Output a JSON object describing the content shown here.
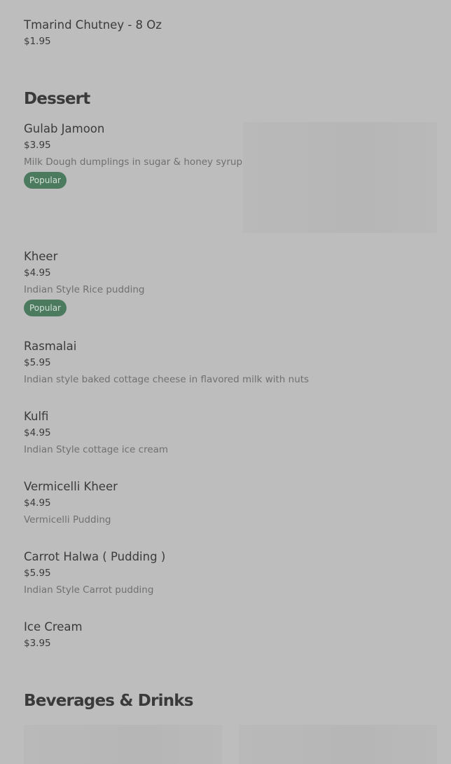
{
  "condiments": {
    "items": [
      {
        "name": "Tmarind Chutney - 8 Oz",
        "price": "$1.95"
      }
    ]
  },
  "dessert": {
    "title": "Dessert",
    "items": [
      {
        "name": "Gulab Jamoon",
        "price": "$3.95",
        "description": "Milk Dough dumplings in sugar & honey syrup",
        "badge": "Popular"
      },
      {
        "name": "Kheer",
        "price": "$4.95",
        "description": "Indian Style Rice pudding",
        "badge": "Popular"
      },
      {
        "name": "Rasmalai",
        "price": "$5.95",
        "description": "Indian style baked cottage cheese in flavored milk with nuts"
      },
      {
        "name": "Kulfi",
        "price": "$4.95",
        "description": "Indian Style cottage ice cream"
      },
      {
        "name": "Vermicelli Kheer",
        "price": "$4.95",
        "description": "Vermicelli Pudding"
      },
      {
        "name": "Carrot Halwa ( Pudding )",
        "price": "$5.95",
        "description": "Indian Style Carrot pudding"
      },
      {
        "name": "Ice Cream",
        "price": "$3.95"
      }
    ]
  },
  "beverages": {
    "title": "Beverages & Drinks"
  }
}
